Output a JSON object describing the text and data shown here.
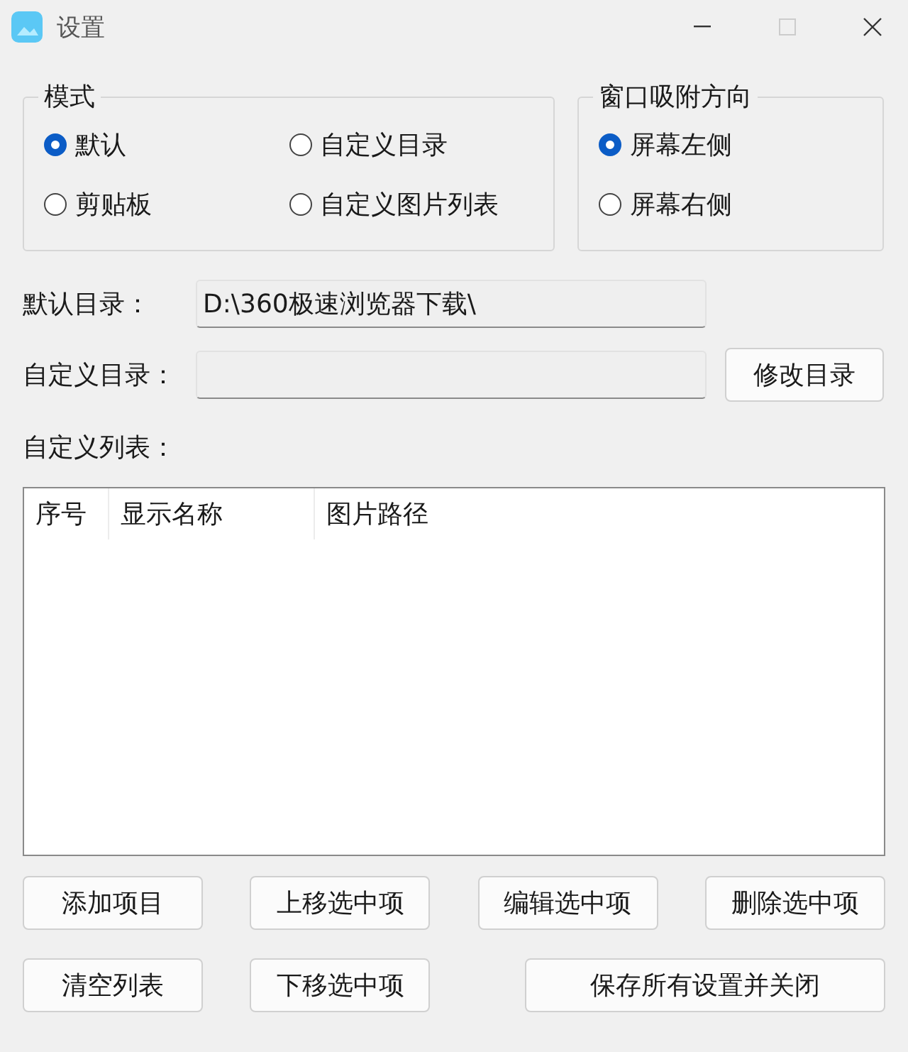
{
  "window": {
    "title": "设置"
  },
  "mode_group": {
    "title": "模式",
    "options": [
      {
        "label": "默认",
        "selected": true
      },
      {
        "label": "自定义目录",
        "selected": false
      },
      {
        "label": "剪贴板",
        "selected": false
      },
      {
        "label": "自定义图片列表",
        "selected": false
      }
    ]
  },
  "dock_group": {
    "title": "窗口吸附方向",
    "options": [
      {
        "label": "屏幕左侧",
        "selected": true
      },
      {
        "label": "屏幕右侧",
        "selected": false
      }
    ]
  },
  "default_dir": {
    "label": "默认目录：",
    "value": "D:\\360极速浏览器下载\\"
  },
  "custom_dir": {
    "label": "自定义目录：",
    "button": "修改目录"
  },
  "list": {
    "label": "自定义列表：",
    "columns": [
      "序号",
      "显示名称",
      "图片路径"
    ]
  },
  "buttons_row1": [
    "添加项目",
    "上移选中项",
    "编辑选中项",
    "删除选中项"
  ],
  "buttons_row2": [
    "清空列表",
    "下移选中项",
    "保存所有设置并关闭"
  ]
}
